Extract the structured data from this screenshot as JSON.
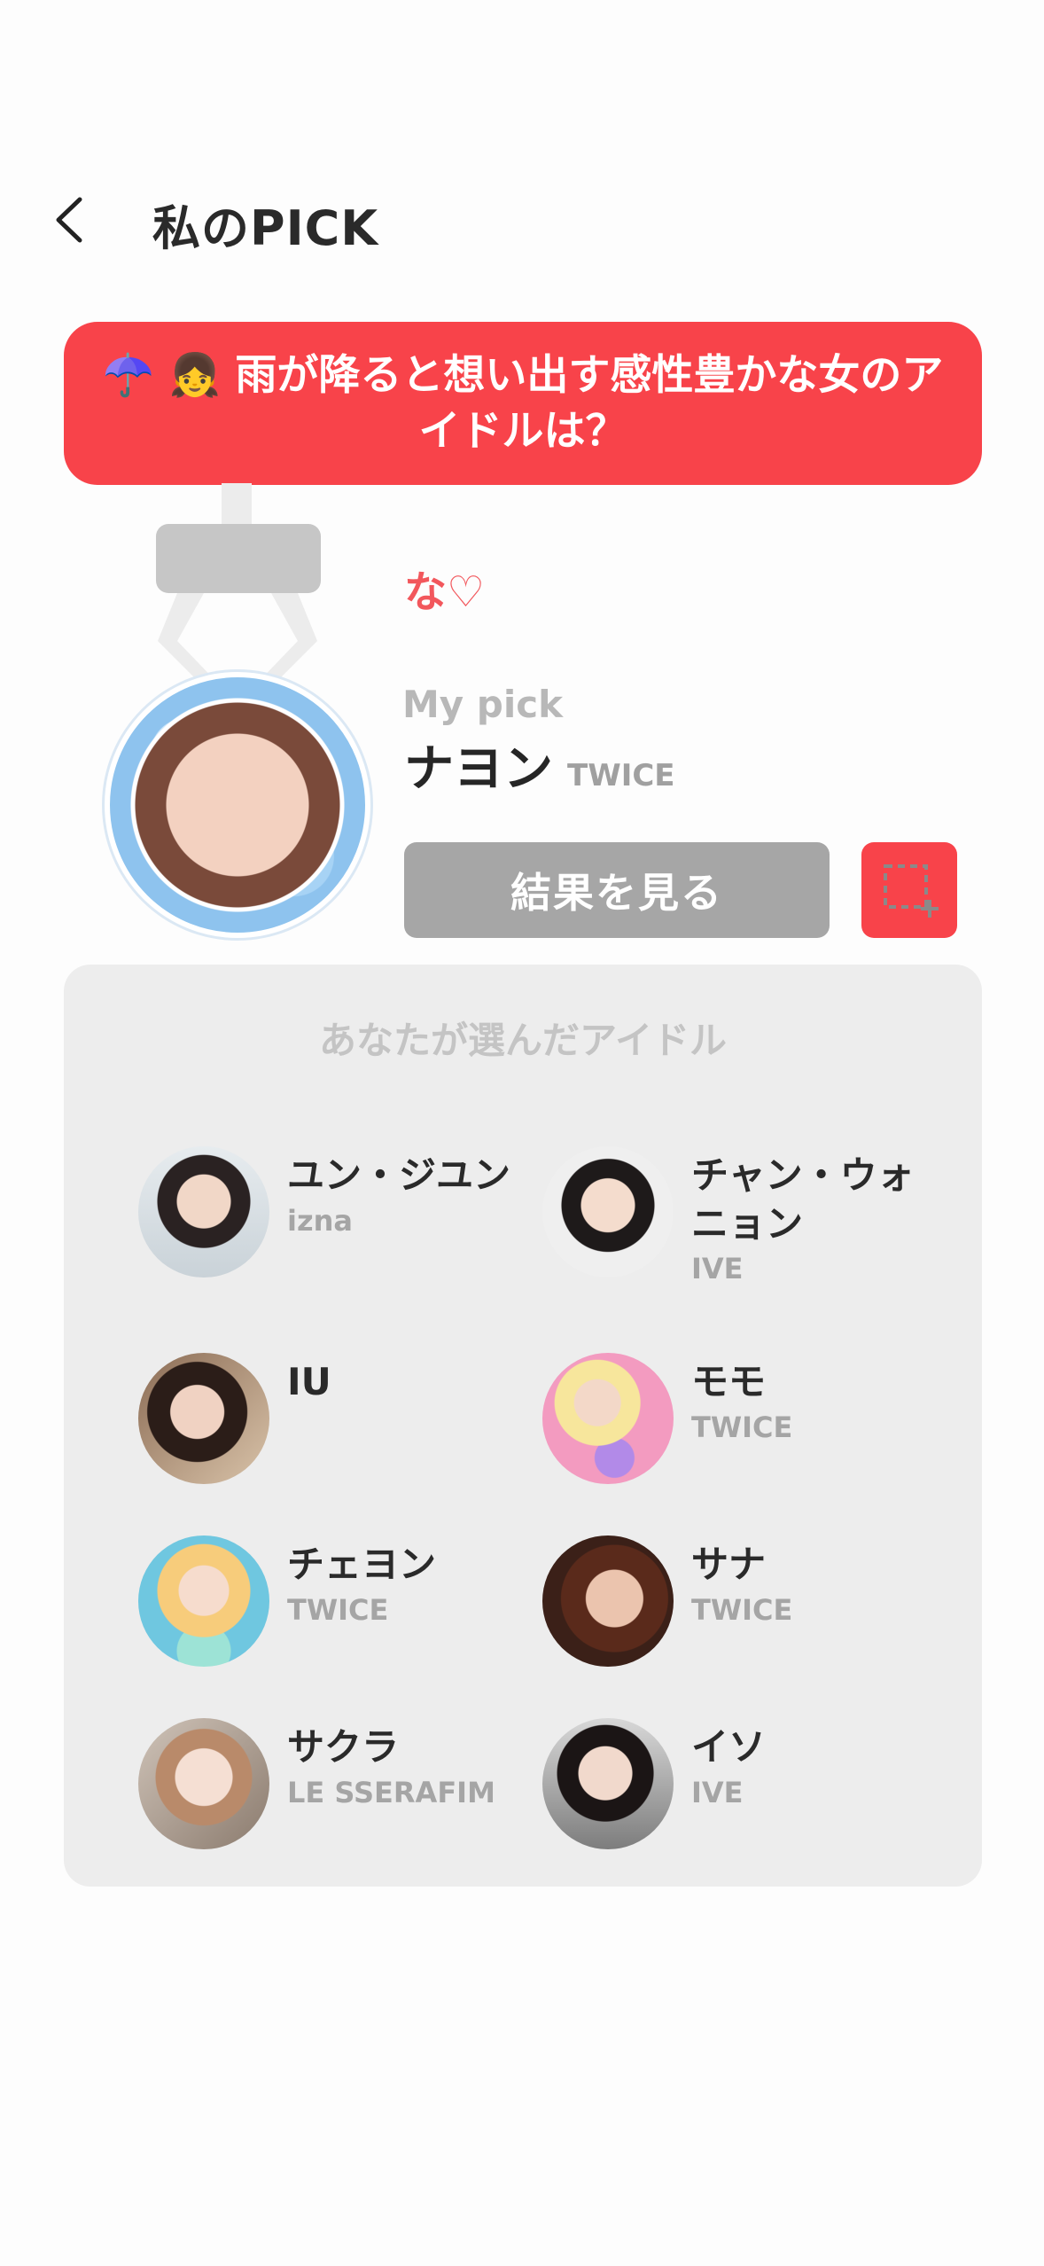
{
  "header": {
    "title": "私のPICK",
    "back_icon": "chevron-left-icon"
  },
  "question": {
    "text": "☂️ 👧 雨が降ると想い出す感性豊かな女のアイドルは？"
  },
  "pick": {
    "comment": "な",
    "comment_heart": "♡",
    "label": "My pick",
    "name": "ナヨン",
    "group": "TWICE"
  },
  "actions": {
    "result_label": "結果を見る",
    "capture_icon": "screenshot-crop-icon"
  },
  "selected": {
    "title": "あなたが選んだアイドル",
    "idols": [
      {
        "name": "ユン・ジユン",
        "group": "izna"
      },
      {
        "name": "チャン・ウォニョン",
        "group": "IVE"
      },
      {
        "name": "IU",
        "group": ""
      },
      {
        "name": "モモ",
        "group": "TWICE"
      },
      {
        "name": "チェヨン",
        "group": "TWICE"
      },
      {
        "name": "サナ",
        "group": "TWICE"
      },
      {
        "name": "サクラ",
        "group": "LE SSERAFIM"
      },
      {
        "name": "イソ",
        "group": "IVE"
      }
    ]
  },
  "colors": {
    "accent": "#f8434a",
    "button_gray": "#a6a6a6",
    "panel_bg": "#ededed"
  }
}
